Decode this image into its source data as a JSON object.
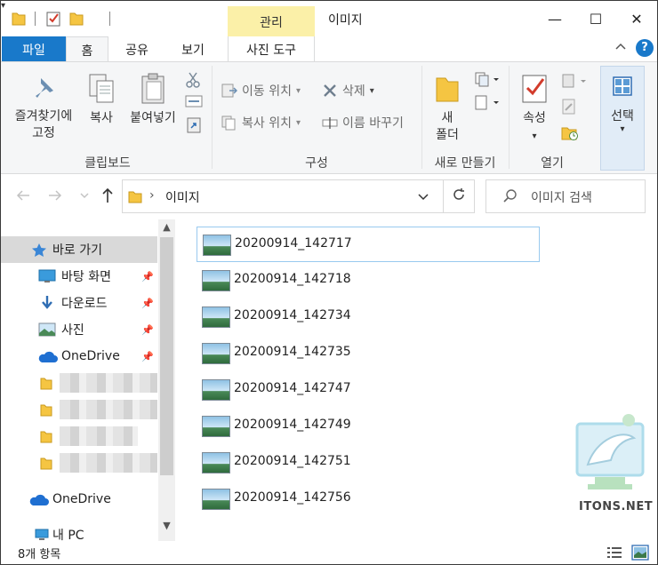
{
  "window": {
    "title": "이미지",
    "context_tab": "관리",
    "controls": {
      "minimize": "—",
      "maximize": "☐",
      "close": "✕"
    }
  },
  "ribbon_tabs": {
    "file": "파일",
    "home": "홈",
    "share": "공유",
    "view": "보기",
    "picture_tools": "사진 도구",
    "collapse_glyph": "^",
    "help_glyph": "?"
  },
  "ribbon": {
    "clipboard": {
      "pin_line1": "즐겨찾기에",
      "pin_line2": "고정",
      "copy": "복사",
      "paste": "붙여넣기",
      "label": "클립보드"
    },
    "organize": {
      "move_to": "이동 위치",
      "copy_to": "복사 위치",
      "delete": "삭제",
      "rename": "이름 바꾸기",
      "label": "구성"
    },
    "new": {
      "new_folder_line1": "새",
      "new_folder_line2": "폴더",
      "label": "새로 만들기"
    },
    "open": {
      "properties": "속성",
      "label": "열기"
    },
    "select": {
      "select": "선택"
    }
  },
  "address": {
    "path": "이미지",
    "search_placeholder": "이미지 검색"
  },
  "nav_pane": {
    "quick_access": "바로 가기",
    "desktop": "바탕 화면",
    "downloads": "다운로드",
    "pictures": "사진",
    "onedrive_pinned": "OneDrive",
    "onedrive": "OneDrive",
    "this_pc": "내 PC"
  },
  "files": [
    "20200914_142717",
    "20200914_142718",
    "20200914_142734",
    "20200914_142735",
    "20200914_142747",
    "20200914_142749",
    "20200914_142751",
    "20200914_142756"
  ],
  "watermark": "ITONS.NET",
  "status": {
    "item_count": "8개 항목"
  },
  "colors": {
    "file_tab": "#1979ca",
    "context_tab": "#fbf0a8",
    "selection_border": "#99c9ef",
    "quick_access_bg": "#d9d9d9",
    "folder_yellow": "#f5c542"
  }
}
